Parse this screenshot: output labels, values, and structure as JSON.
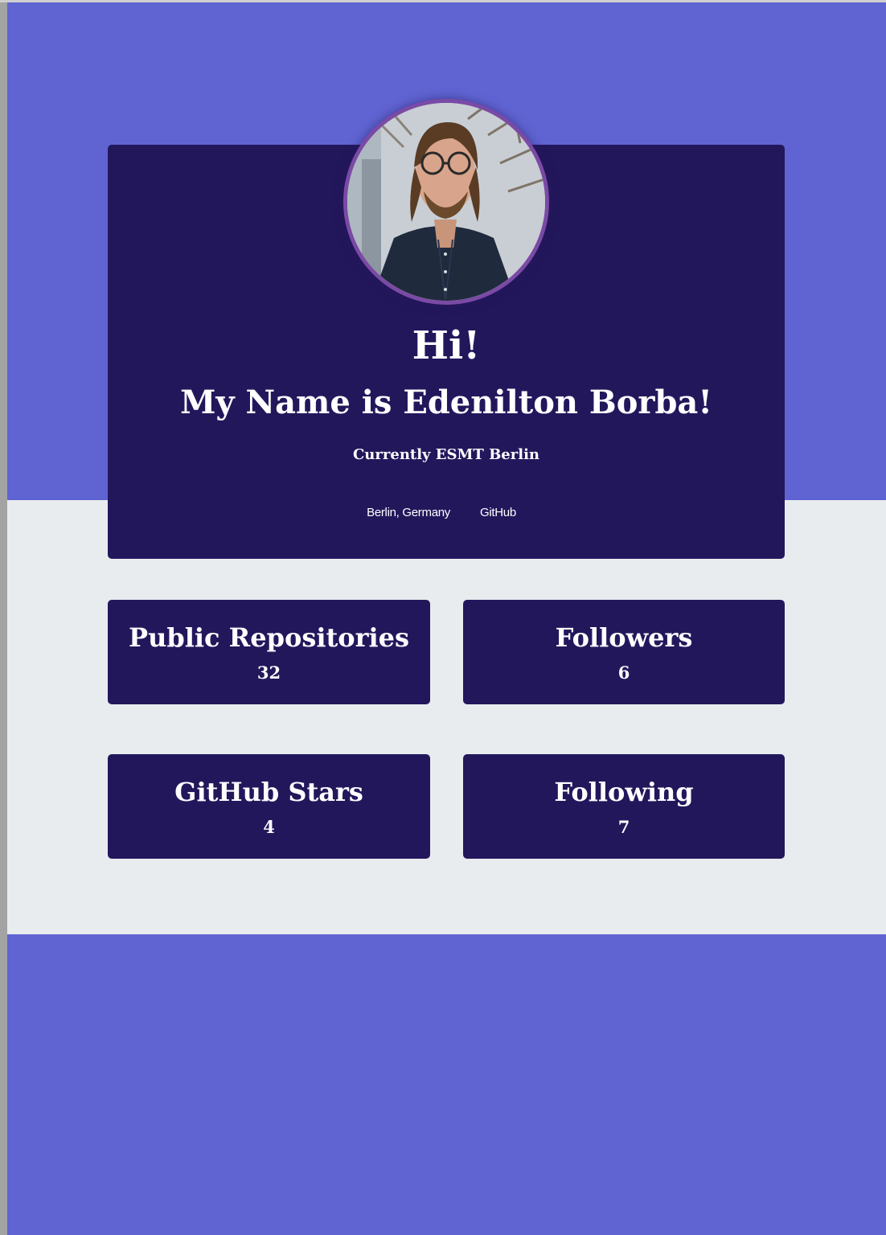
{
  "theme": {
    "primary_background": "#5f64d2",
    "secondary_background": "#e8ecee",
    "card_background": "#23175c",
    "avatar_ring": "#7a4aa5",
    "text": "#ffffff"
  },
  "profile": {
    "greeting": "Hi!",
    "name_line": "My Name is Edenilton Borba!",
    "current": "Currently ESMT Berlin",
    "location": "Berlin, Germany",
    "github_link": "GitHub",
    "avatar_icon": "profile-photo"
  },
  "stats": [
    {
      "label": "Public Repositories",
      "value": "32"
    },
    {
      "label": "Followers",
      "value": "6"
    },
    {
      "label": "GitHub Stars",
      "value": "4"
    },
    {
      "label": "Following",
      "value": "7"
    }
  ]
}
